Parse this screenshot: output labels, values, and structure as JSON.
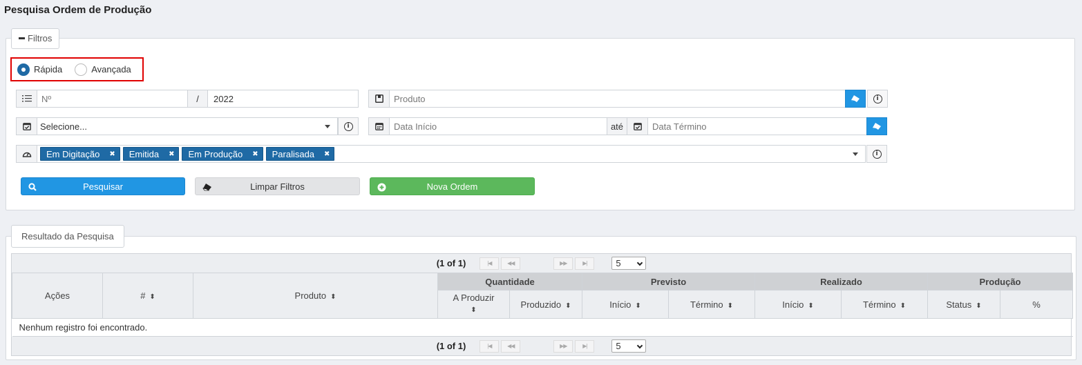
{
  "page_title": "Pesquisa Ordem de Produção",
  "filters": {
    "legend": "Filtros",
    "mode": {
      "options": [
        "Rápida",
        "Avançada"
      ],
      "selected": "Rápida"
    },
    "numero_placeholder": "Nº",
    "separator": "/",
    "ano_value": "2022",
    "produto_placeholder": "Produto",
    "tipo_select": "Selecione...",
    "data_inicio_placeholder": "Data Início",
    "ate_label": "até",
    "data_termino_placeholder": "Data Término",
    "status_chips": [
      "Em Digitação",
      "Emitida",
      "Em Produção",
      "Paralisada"
    ],
    "chip_remove": "✖"
  },
  "buttons": {
    "pesquisar": "Pesquisar",
    "limpar": "Limpar Filtros",
    "nova": "Nova Ordem"
  },
  "results": {
    "legend": "Resultado da Pesquisa",
    "pager_text": "(1 of 1)",
    "rows_per_page": "5",
    "columns": {
      "acoes": "Ações",
      "num": "#",
      "produto": "Produto",
      "quantidade": "Quantidade",
      "a_produzir": "A Produzir",
      "produzido": "Produzido",
      "previsto": "Previsto",
      "prev_inicio": "Início",
      "prev_termino": "Término",
      "realizado": "Realizado",
      "real_inicio": "Início",
      "real_termino": "Término",
      "producao": "Produção",
      "status": "Status",
      "percent": "%"
    },
    "empty_message": "Nenhum registro foi encontrado."
  },
  "colors": {
    "primary": "#2196e3",
    "success": "#5cb85c",
    "chip": "#1f6aa5",
    "highlight": "#e00000"
  }
}
